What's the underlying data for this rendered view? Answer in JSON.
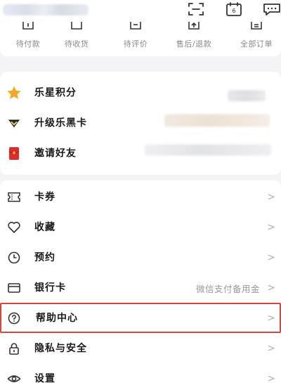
{
  "header": {
    "username_blurred": true,
    "icons": [
      "scan-icon",
      "calendar-icon",
      "message-icon"
    ]
  },
  "orders": [
    {
      "label": "待付款",
      "icon": "wallet-icon"
    },
    {
      "label": "待收货",
      "icon": "box-icon"
    },
    {
      "label": "待评价",
      "icon": "review-icon"
    },
    {
      "label": "售后/退款",
      "icon": "refund-icon"
    },
    {
      "label": "全部订单",
      "icon": "orders-icon"
    }
  ],
  "rewards": [
    {
      "label": "乐星积分",
      "icon": "star-icon",
      "color": "#f5a623"
    },
    {
      "label": "升级乐黑卡",
      "icon": "diamond-icon",
      "color": "#2b2b2b"
    },
    {
      "label": "邀请好友",
      "icon": "red-envelope-icon",
      "color": "#e02b2b"
    }
  ],
  "menu": [
    {
      "label": "卡券",
      "icon": "coupon-icon",
      "value": "",
      "chevron": ">"
    },
    {
      "label": "收藏",
      "icon": "heart-icon",
      "value": "",
      "chevron": ">"
    },
    {
      "label": "预约",
      "icon": "clock-icon",
      "value": "",
      "chevron": ">"
    },
    {
      "label": "银行卡",
      "icon": "bank-card-icon",
      "value": "微信支付备用金",
      "chevron": ">"
    },
    {
      "label": "帮助中心",
      "icon": "help-icon",
      "value": "",
      "chevron": ">",
      "highlighted": true
    },
    {
      "label": "隐私与安全",
      "icon": "lock-icon",
      "value": "",
      "chevron": ">"
    },
    {
      "label": "设置",
      "icon": "settings-icon",
      "value": "",
      "chevron": ">"
    }
  ],
  "highlight_color": "#d7473f"
}
